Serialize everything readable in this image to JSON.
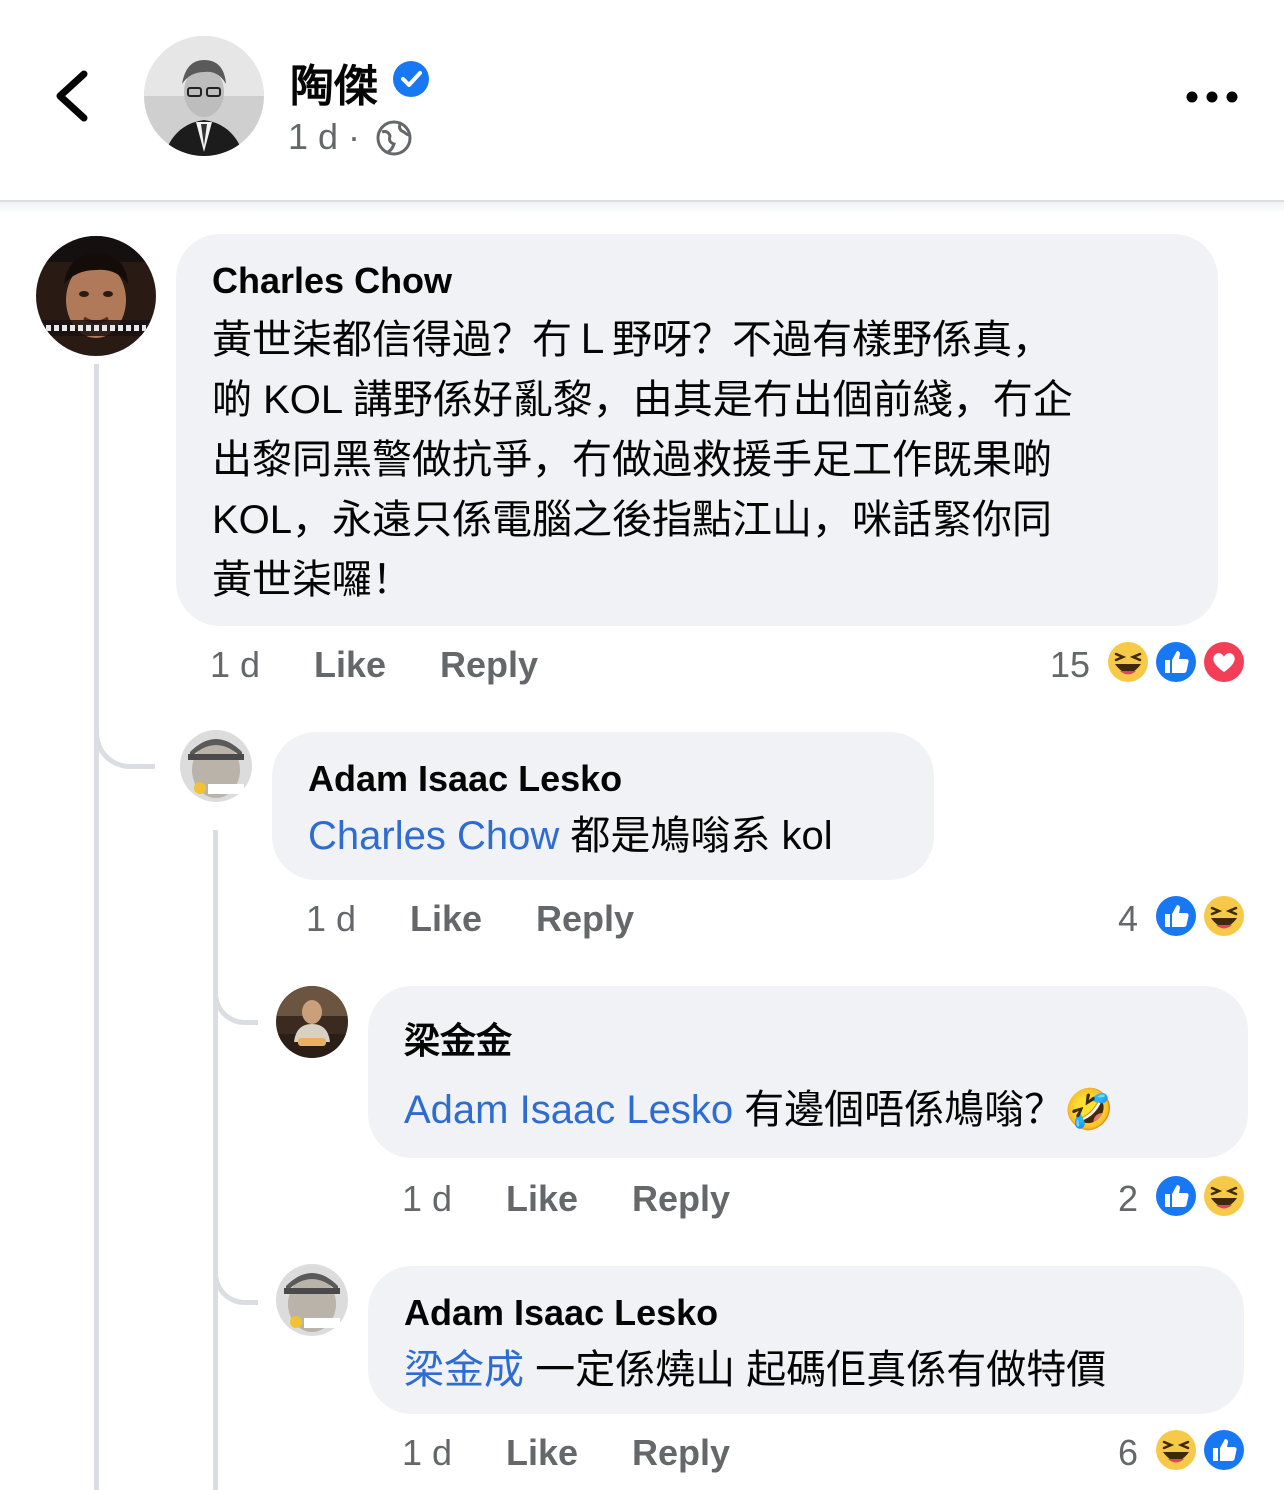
{
  "header": {
    "name": "陶傑",
    "time": "1 d ·"
  },
  "actions": {
    "like": "Like",
    "reply": "Reply"
  },
  "comments": [
    {
      "author": "Charles Chow",
      "mention": "",
      "lines": [
        "黃世柒都信得過？冇Ｌ野呀？不過有樣野係真，",
        "啲 KOL 講野係好亂黎，由其是冇出個前綫，冇企",
        "出黎同黑警做抗爭，冇做過救援手足工作既果啲",
        "KOL，永遠只係電腦之後指點江山，咪話緊你同",
        "黃世柒囉！"
      ],
      "time": "1 d",
      "count": "15",
      "reactions": [
        "haha",
        "like",
        "love"
      ]
    },
    {
      "author": "Adam Isaac Lesko",
      "mention": "Charles Chow",
      "text": " 都是鳩嗡系 kol",
      "time": "1 d",
      "count": "4",
      "reactions": [
        "like",
        "haha"
      ]
    },
    {
      "author": "梁金金",
      "mention": "Adam Isaac Lesko",
      "text": " 有邊個唔係鳩嗡？🤣",
      "time": "1 d",
      "count": "2",
      "reactions": [
        "like",
        "haha"
      ]
    },
    {
      "author": "Adam Isaac Lesko",
      "mention": "梁金成",
      "text": " 一定係燒山 起碼佢真係有做特價",
      "time": "1 d",
      "count": "6",
      "reactions": [
        "haha",
        "like"
      ]
    }
  ]
}
